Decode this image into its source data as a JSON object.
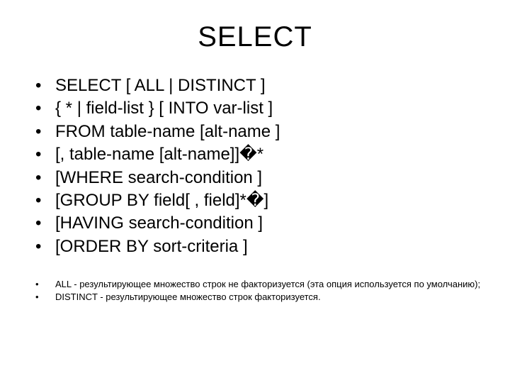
{
  "title": "SELECT",
  "syntax": [
    " SELECT  [ ALL | DISTINCT ]",
    "{  * | field-list } [ INTO var-list ]",
    "FROM  table-name [alt-name ]",
    "            [, table-name [alt-name]]�*",
    "[WHERE search-condition ]",
    "[GROUP BY field[ , field]*�]",
    "[HAVING search-condition ]",
    "[ORDER BY sort-criteria ]"
  ],
  "notes": [
    "ALL - результирующее множество строк не факторизуется  (эта опция используется по умолчанию);",
    "DISTINCT - результирующее множество строк факторизуется."
  ]
}
